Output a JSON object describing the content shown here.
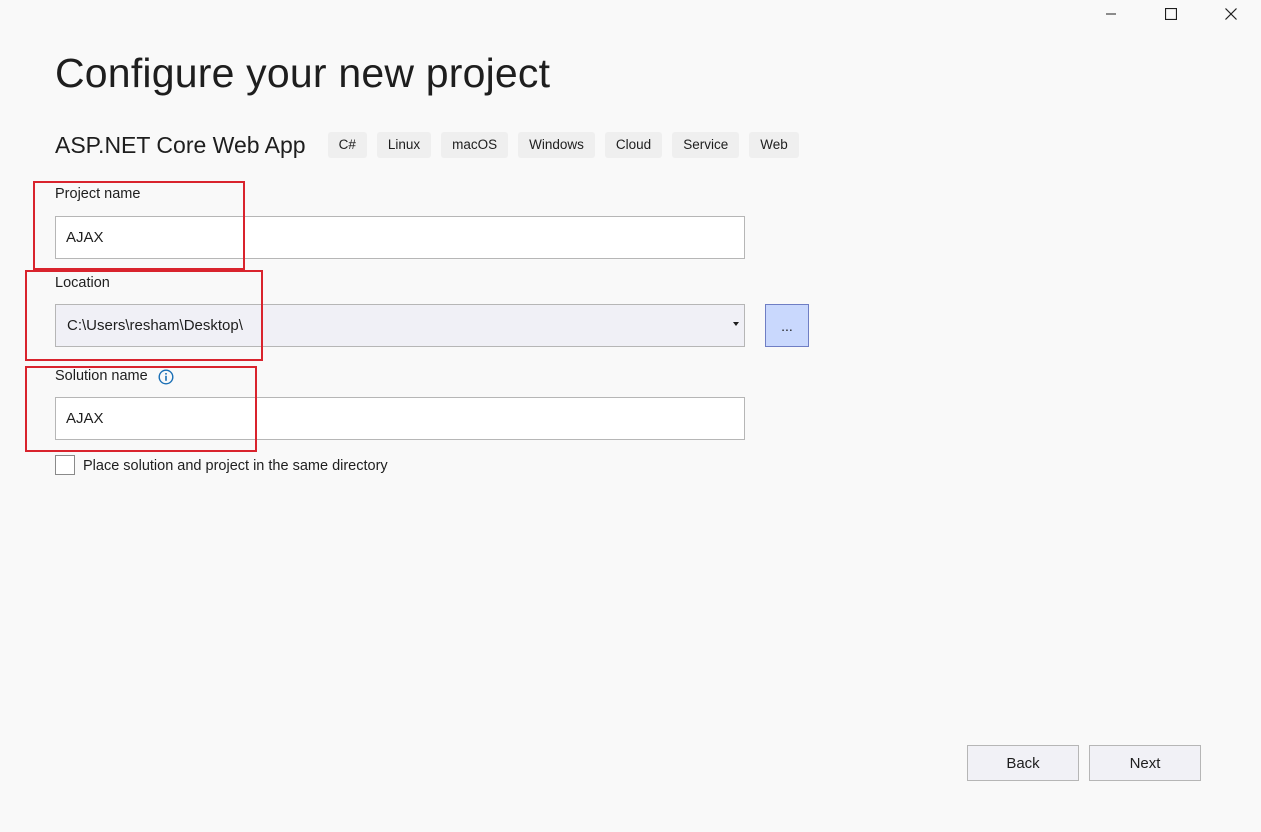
{
  "header": {
    "title": "Configure your new project"
  },
  "template": {
    "name": "ASP.NET Core Web App",
    "tags": [
      "C#",
      "Linux",
      "macOS",
      "Windows",
      "Cloud",
      "Service",
      "Web"
    ]
  },
  "form": {
    "project_name": {
      "label": "Project name",
      "value": "AJAX"
    },
    "location": {
      "label": "Location",
      "value": "C:\\Users\\resham\\Desktop\\",
      "browse_label": "..."
    },
    "solution_name": {
      "label": "Solution name",
      "value": "AJAX"
    },
    "same_directory": {
      "label": "Place solution and project in the same directory",
      "checked": false
    }
  },
  "footer": {
    "back_label": "Back",
    "next_label": "Next"
  },
  "colors": {
    "background": "#f9f9f9",
    "highlight": "#d9232d",
    "browse_button": "#c9d8fd",
    "info_icon": "#1a6fb5"
  },
  "icons": {
    "minimize": "minimize-icon",
    "maximize": "maximize-icon",
    "close": "close-icon",
    "info": "info-icon",
    "dropdown": "chevron-down-icon"
  }
}
